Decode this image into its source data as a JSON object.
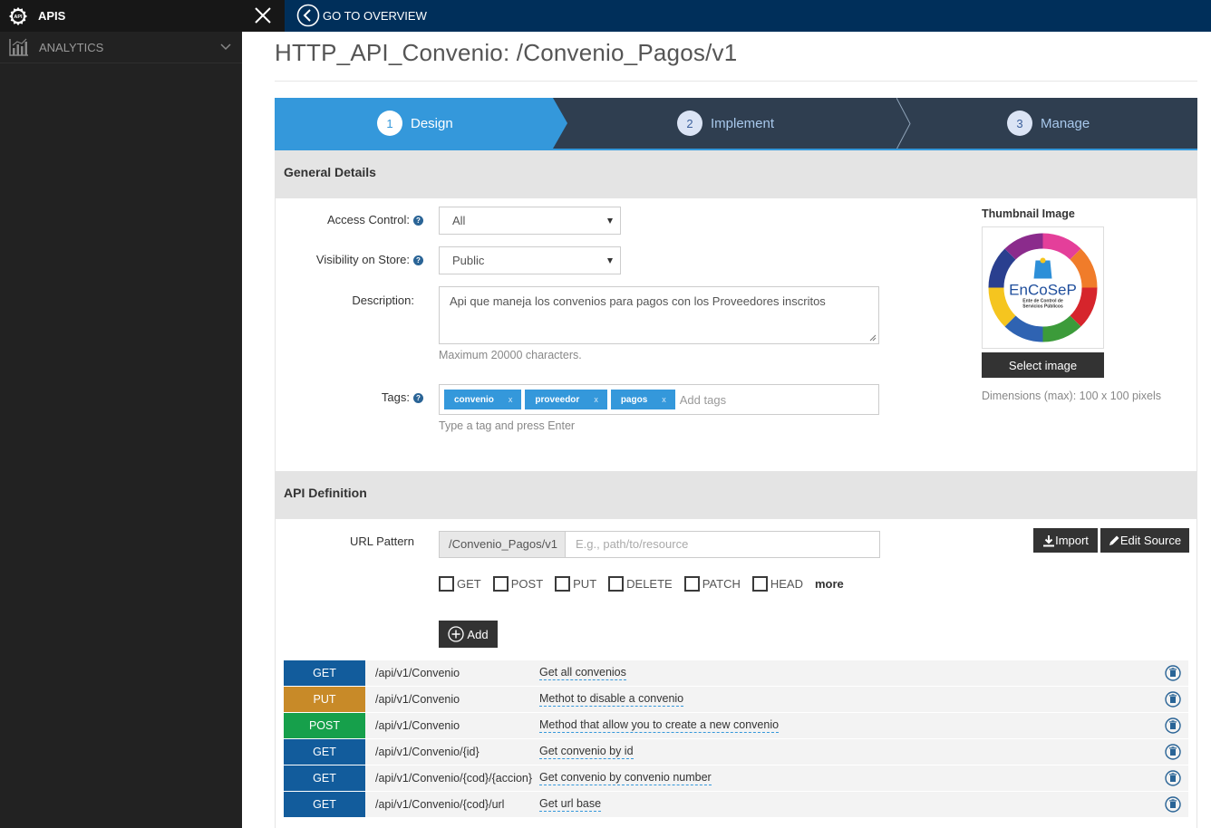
{
  "sidebar": {
    "top_label": "APIS",
    "items": [
      {
        "label": "ANALYTICS",
        "icon": "bar-chart-icon"
      }
    ]
  },
  "topbar": {
    "goto_label": "GO TO OVERVIEW"
  },
  "page": {
    "title": "HTTP_API_Convenio: /Convenio_Pagos/v1"
  },
  "wizard": {
    "steps": [
      {
        "num": "1",
        "label": "Design",
        "state": "active"
      },
      {
        "num": "2",
        "label": "Implement",
        "state": "inactive"
      },
      {
        "num": "3",
        "label": "Manage",
        "state": "inactive"
      }
    ]
  },
  "general": {
    "heading": "General Details",
    "access_control": {
      "label": "Access Control:",
      "value": "All"
    },
    "visibility": {
      "label": "Visibility on Store:",
      "value": "Public"
    },
    "description": {
      "label": "Description:",
      "value": "Api que maneja los convenios para pagos con los Proveedores inscritos",
      "hint": "Maximum 20000 characters."
    },
    "tags": {
      "label": "Tags:",
      "items": [
        "convenio",
        "proveedor",
        "pagos"
      ],
      "remove_glyph": "x",
      "placeholder": "Add tags",
      "hint": "Type a tag and press Enter"
    },
    "thumbnail": {
      "label": "Thumbnail Image",
      "logo_text": "EnCoSeP",
      "logo_sub1": "Ente de Control de",
      "logo_sub2": "Servicios Públicos",
      "select_button": "Select image",
      "dimensions": "Dimensions (max): 100 x 100 pixels"
    }
  },
  "api_definition": {
    "heading": "API Definition",
    "url_label": "URL Pattern",
    "url_prefix": "/Convenio_Pagos/v1",
    "url_placeholder": "E.g., path/to/resource",
    "import_button": "Import",
    "edit_source_button": "Edit Source",
    "methods": [
      "GET",
      "POST",
      "PUT",
      "DELETE",
      "PATCH",
      "HEAD"
    ],
    "more_label": "more",
    "add_button": "Add",
    "verb_colors": {
      "GET": "#125c9c",
      "PUT": "#c88a28",
      "POST": "#16a04b"
    },
    "resources": [
      {
        "verb": "GET",
        "path": "/api/v1/Convenio",
        "desc": "Get all convenios"
      },
      {
        "verb": "PUT",
        "path": "/api/v1/Convenio",
        "desc": "Methot to disable a convenio"
      },
      {
        "verb": "POST",
        "path": "/api/v1/Convenio",
        "desc": "Method that allow you to create a new convenio"
      },
      {
        "verb": "GET",
        "path": "/api/v1/Convenio/{id}",
        "desc": "Get convenio by id"
      },
      {
        "verb": "GET",
        "path": "/api/v1/Convenio/{cod}/{accion}",
        "desc": "Get convenio by convenio number"
      },
      {
        "verb": "GET",
        "path": "/api/v1/Convenio/{cod}/url",
        "desc": "Get url base"
      }
    ]
  }
}
